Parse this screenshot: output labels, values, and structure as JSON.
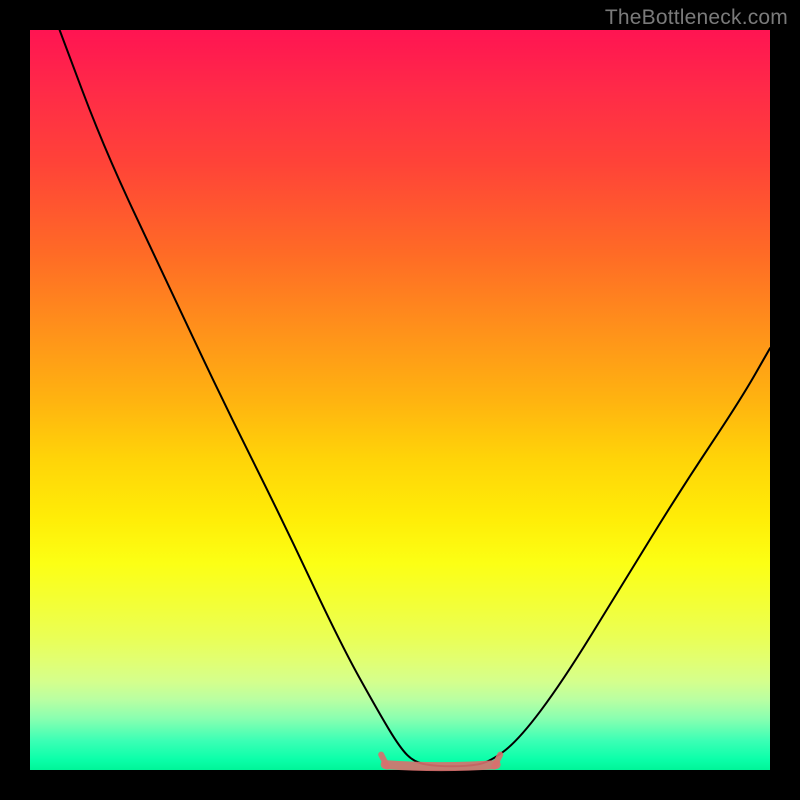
{
  "watermark": "TheBottleneck.com",
  "chart_data": {
    "type": "line",
    "title": "",
    "xlabel": "",
    "ylabel": "",
    "xlim": [
      0,
      100
    ],
    "ylim": [
      0,
      100
    ],
    "grid": false,
    "legend": false,
    "series": [
      {
        "name": "curve",
        "x": [
          4,
          10,
          18,
          26,
          34,
          42,
          47,
          50,
          52,
          55,
          59,
          62,
          66,
          72,
          80,
          88,
          96,
          100
        ],
        "y": [
          100,
          84,
          67,
          50,
          34,
          17,
          8,
          3,
          1,
          0.5,
          0.5,
          1,
          4,
          12,
          25,
          38,
          50,
          57
        ]
      }
    ],
    "highlight_band": {
      "x_start": 48,
      "x_end": 63,
      "y": 1,
      "color": "#d9706e"
    },
    "background_gradient": {
      "top": "#ff1452",
      "mid": "#ffed07",
      "bottom": "#00f598"
    }
  }
}
